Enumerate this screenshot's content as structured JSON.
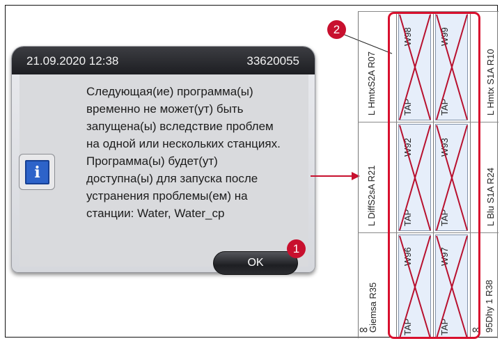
{
  "dialog": {
    "date": "21.09.2020 12:38",
    "id": "33620055",
    "message": "Следующая(ие) программа(ы)\nвременно не может(ут) быть\nзапущена(ы) вследствие проблем\nна одной или нескольких станциях.\nПрограмма(ы) будет(ут)\nдоступна(ы) для запуска после\nустранения проблемы(ем) на\nстанции: Water, Water_cp",
    "ok_label": "OK",
    "icon": "info-icon"
  },
  "callouts": {
    "c1": "1",
    "c2": "2"
  },
  "stations": {
    "row1": {
      "left": "L HmtxS2A  R07",
      "w1": "W98",
      "w2": "W99",
      "right": "L Hmtx S1A  R10"
    },
    "row2": {
      "left": "L DiffS2sA  R21",
      "w1": "W92",
      "w2": "W93",
      "right": "L Blu S1A  R24"
    },
    "row3": {
      "left": "Giemsa  R35",
      "w1": "W96",
      "w2": "W97",
      "right": "95Dhy 1  R38"
    },
    "tap_label": "TAP",
    "infinity": "∞"
  },
  "colors": {
    "accent": "#d8102e",
    "cell": "#e6eefa",
    "header": "#2a2b30"
  }
}
